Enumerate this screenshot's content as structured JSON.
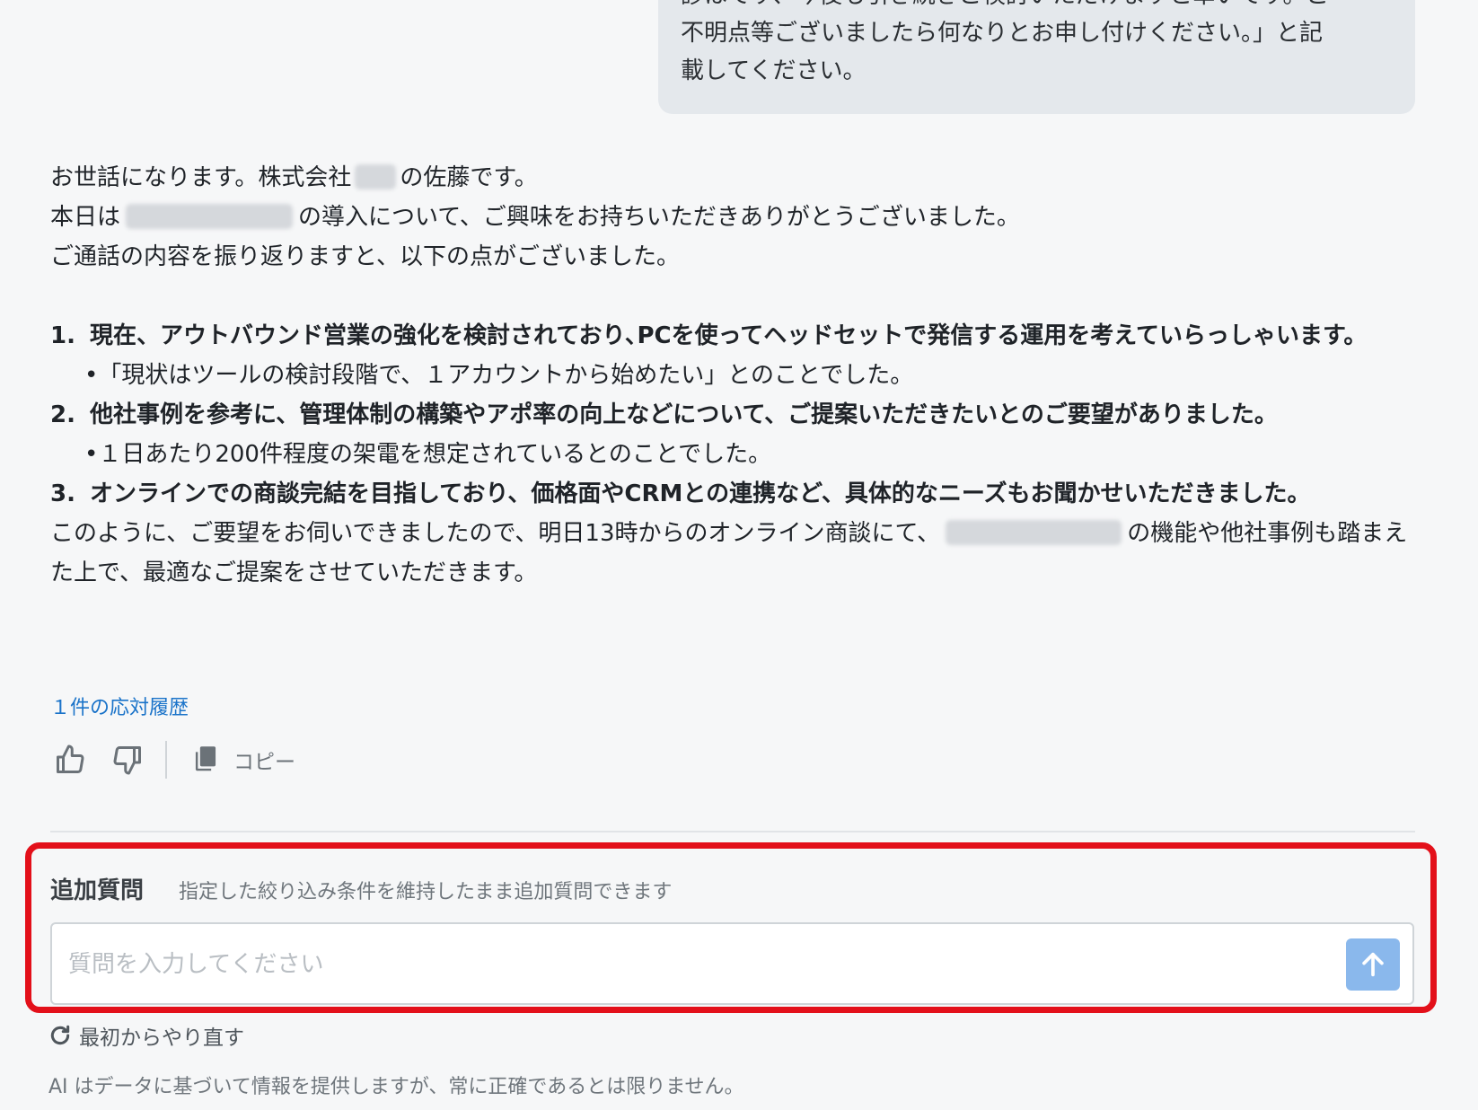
{
  "user_message": {
    "lines": [
      "診はです、今後も引き続きご検討いただけますと幸いです。ご",
      "不明点等ございましたら何なりとお申し付けください。」と記",
      "載してください。"
    ]
  },
  "answer": {
    "p1_before": "お世話になります。株式会社",
    "p1_after": "の佐藤です。",
    "p2_before": "本日は",
    "p2_after": "の導入について、ご興味をお持ちいただきありがとうございました。",
    "p3": "ご通話の内容を振り返りますと、以下の点がございました。",
    "items": [
      {
        "num": "1.",
        "head": "現在、アウトバウンド営業の強化を検討されており､PCを使ってヘッドセットで発信する運用を考えていらっしゃいます。",
        "sub": "•「現状はツールの検討段階で、１アカウントから始めたい」とのことでした。"
      },
      {
        "num": "2.",
        "head": "他社事例を参考に、管理体制の構築やアポ率の向上などについて、ご提案いただきたいとのご要望がありました。",
        "sub": "•１日あたり200件程度の架電を想定されているとのことでした。"
      },
      {
        "num": "3.",
        "head": "オンラインでの商談完結を目指しており、価格面やCRMとの連携など、具体的なニーズもお聞かせいただきました。",
        "sub": ""
      }
    ],
    "closing_before": "このように、ご要望をお伺いできましたので、明日13時からのオンライン商談にて、",
    "closing_after": "の機能や他社事例も踏まえた上で、最適なご提案をさせていただきます。"
  },
  "history_link": "１件の応対履歴",
  "actions": {
    "copy_label": "コピー"
  },
  "followup": {
    "title": "追加質問",
    "note": "指定した絞り込み条件を維持したまま追加質問できます",
    "input_value": "",
    "input_placeholder": "質問を入力してください"
  },
  "restart_label": "最初からやり直す",
  "disclaimer": "AI はデータに基づいて情報を提供しますが、常に正確であるとは限りません。",
  "colors": {
    "accent_link": "#1a73c9",
    "highlight_border": "#e3101a",
    "send_button": "#8ab8ec",
    "user_bubble": "#e4e8ec"
  }
}
